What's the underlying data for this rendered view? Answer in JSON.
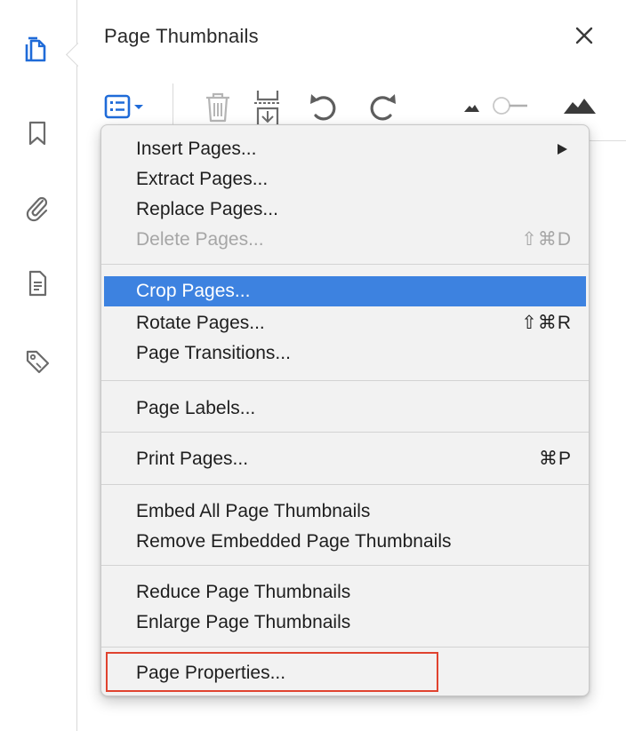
{
  "panel": {
    "title": "Page Thumbnails"
  },
  "toolbar": {
    "icons": [
      "options-menu-icon",
      "trash-icon",
      "insert-page-icon",
      "rotate-left-icon",
      "rotate-right-icon",
      "small-thumbnail-icon",
      "thumbnail-size-slider",
      "large-thumbnail-icon"
    ]
  },
  "rail": {
    "icons": [
      "page-thumbnails-icon",
      "bookmark-icon",
      "attachment-icon",
      "document-icon",
      "tag-icon"
    ]
  },
  "menu": {
    "insert_pages": "Insert Pages...",
    "extract_pages": "Extract Pages...",
    "replace_pages": "Replace Pages...",
    "delete_pages": "Delete Pages...",
    "delete_shortcut": "⇧⌘D",
    "crop_pages": "Crop Pages...",
    "rotate_pages": "Rotate Pages...",
    "rotate_shortcut": "⇧⌘R",
    "page_transitions": "Page Transitions...",
    "page_labels": "Page Labels...",
    "print_pages": "Print Pages...",
    "print_shortcut": "⌘P",
    "embed_thumbnails": "Embed All Page Thumbnails",
    "remove_thumbnails": "Remove Embedded Page Thumbnails",
    "reduce_thumbnails": "Reduce Page Thumbnails",
    "enlarge_thumbnails": "Enlarge Page Thumbnails",
    "page_properties": "Page Properties..."
  },
  "colors": {
    "highlight": "#3d82e0",
    "accent_blue": "#1f6bd8",
    "callout_red": "#e0432f"
  }
}
